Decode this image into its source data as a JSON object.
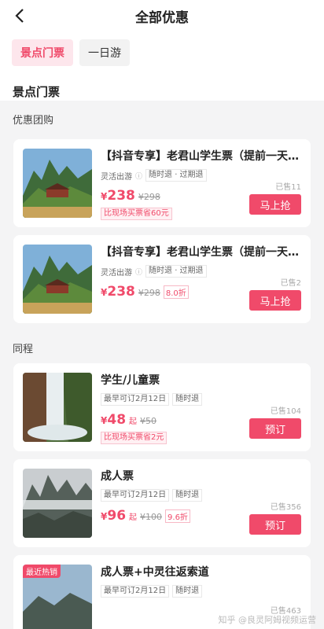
{
  "header": {
    "title": "全部优惠"
  },
  "tabs": [
    {
      "label": "景点门票"
    },
    {
      "label": "一日游"
    }
  ],
  "section": {
    "title": "景点门票",
    "subheading": "优惠团购",
    "group2": "同程"
  },
  "cards": [
    {
      "name": "【抖音专享】老君山学生票（提前一天…",
      "tag1": "灵活出游",
      "tag2": "随时退 · 过期退",
      "price": "238",
      "orig": "¥298",
      "save": "比现场买票省60元",
      "sold": "已售11",
      "button": "马上抢"
    },
    {
      "name": "【抖音专享】老君山学生票（提前一天…",
      "tag1": "灵活出游",
      "tag2": "随时退 · 过期退",
      "price": "238",
      "orig": "¥298",
      "discount": "8.0折",
      "sold": "已售2",
      "button": "马上抢"
    },
    {
      "name": "学生/儿童票",
      "tag1": "最早可订2月12日",
      "tag2": "随时退",
      "price": "48",
      "suffix": "起",
      "orig": "¥50",
      "save": "比现场买票省2元",
      "sold": "已售104",
      "button": "预订"
    },
    {
      "name": "成人票",
      "tag1": "最早可订2月12日",
      "tag2": "随时退",
      "price": "96",
      "suffix": "起",
      "orig": "¥100",
      "discount": "9.6折",
      "sold": "已售356",
      "button": "预订"
    },
    {
      "badge": "最近热销",
      "name": "成人票+中灵往返索道",
      "tag1": "最早可订2月12日",
      "tag2": "随时退",
      "sold": "已售463"
    }
  ],
  "watermark": "知乎 @良灵阿姆视频运营",
  "colors": {
    "accent": "#f04a6a",
    "tab_active_bg": "#fde6ec"
  }
}
